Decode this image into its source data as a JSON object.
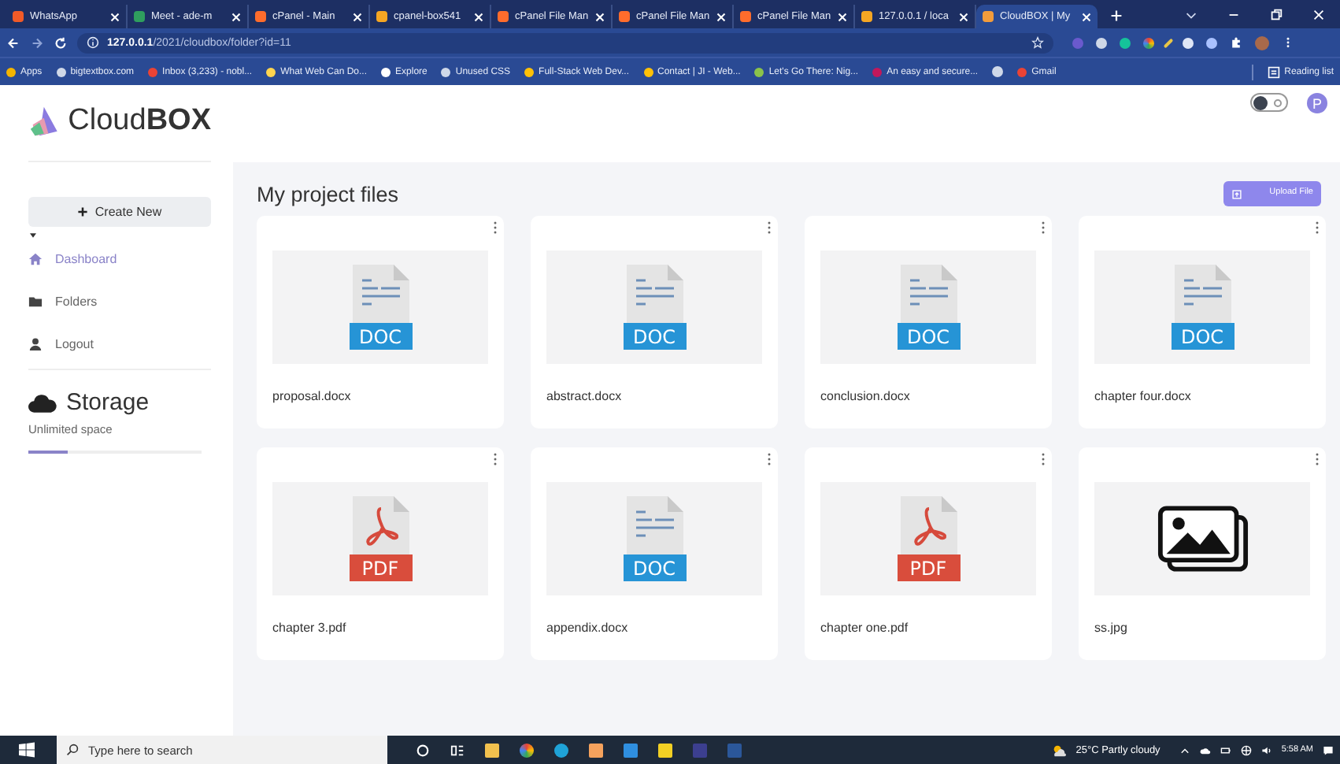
{
  "browser": {
    "tabs": [
      {
        "title": "WhatsApp",
        "selected": false
      },
      {
        "title": "Meet - ade-m",
        "selected": false
      },
      {
        "title": "cPanel - Main",
        "selected": false
      },
      {
        "title": "cpanel-box541",
        "selected": false
      },
      {
        "title": "cPanel File Man",
        "selected": false
      },
      {
        "title": "cPanel File Man",
        "selected": false
      },
      {
        "title": "cPanel File Man",
        "selected": false
      },
      {
        "title": "127.0.0.1 / loca",
        "selected": false
      },
      {
        "title": "CloudBOX | My",
        "selected": true
      }
    ],
    "address": {
      "host": "127.0.0.1",
      "path": "/2021/cloudbox/folder?id=11"
    },
    "bookmarks": [
      {
        "label": "Apps"
      },
      {
        "label": "bigtextbox.com"
      },
      {
        "label": "Inbox (3,233) - nobl..."
      },
      {
        "label": "What Web Can Do..."
      },
      {
        "label": "Explore"
      },
      {
        "label": "Unused CSS"
      },
      {
        "label": "Full-Stack Web Dev..."
      },
      {
        "label": "Contact | JI - Web..."
      },
      {
        "label": "Let's Go There: Nig..."
      },
      {
        "label": "An easy and secure..."
      },
      {
        "label": "Gmail"
      }
    ],
    "reading_list": "Reading list"
  },
  "app": {
    "brand": "Cloud**BOX**",
    "create_button": "Create New",
    "nav": [
      {
        "label": "Dashboard",
        "selected": true
      },
      {
        "label": "Folders",
        "selected": false
      },
      {
        "label": "Logout",
        "selected": false
      }
    ],
    "storage": {
      "title": "Storage",
      "subtitle": "Unlimited space",
      "level": 0.23
    },
    "dark_mode": {
      "on": false
    },
    "avatar": "P",
    "heading": "My project files",
    "upload_button": "Upload File",
    "files": [
      {
        "name": "proposal.docx",
        "kind": "doc",
        "badge": "DOC"
      },
      {
        "name": "abstract.docx",
        "kind": "doc",
        "badge": "DOC"
      },
      {
        "name": "conclusion.docx",
        "kind": "doc",
        "badge": "DOC"
      },
      {
        "name": "chapter four.docx",
        "kind": "doc",
        "badge": "DOC"
      },
      {
        "name": "chapter 3.pdf",
        "kind": "pdf",
        "badge": "PDF"
      },
      {
        "name": "appendix.docx",
        "kind": "doc",
        "badge": "DOC"
      },
      {
        "name": "chapter one.pdf",
        "kind": "pdf",
        "badge": "PDF"
      },
      {
        "name": "ss.jpg",
        "kind": "image"
      }
    ]
  },
  "taskbar": {
    "search_placeholder": "Type here to search",
    "weather": "25°C  Partly cloudy",
    "time": "5:58 AM"
  }
}
